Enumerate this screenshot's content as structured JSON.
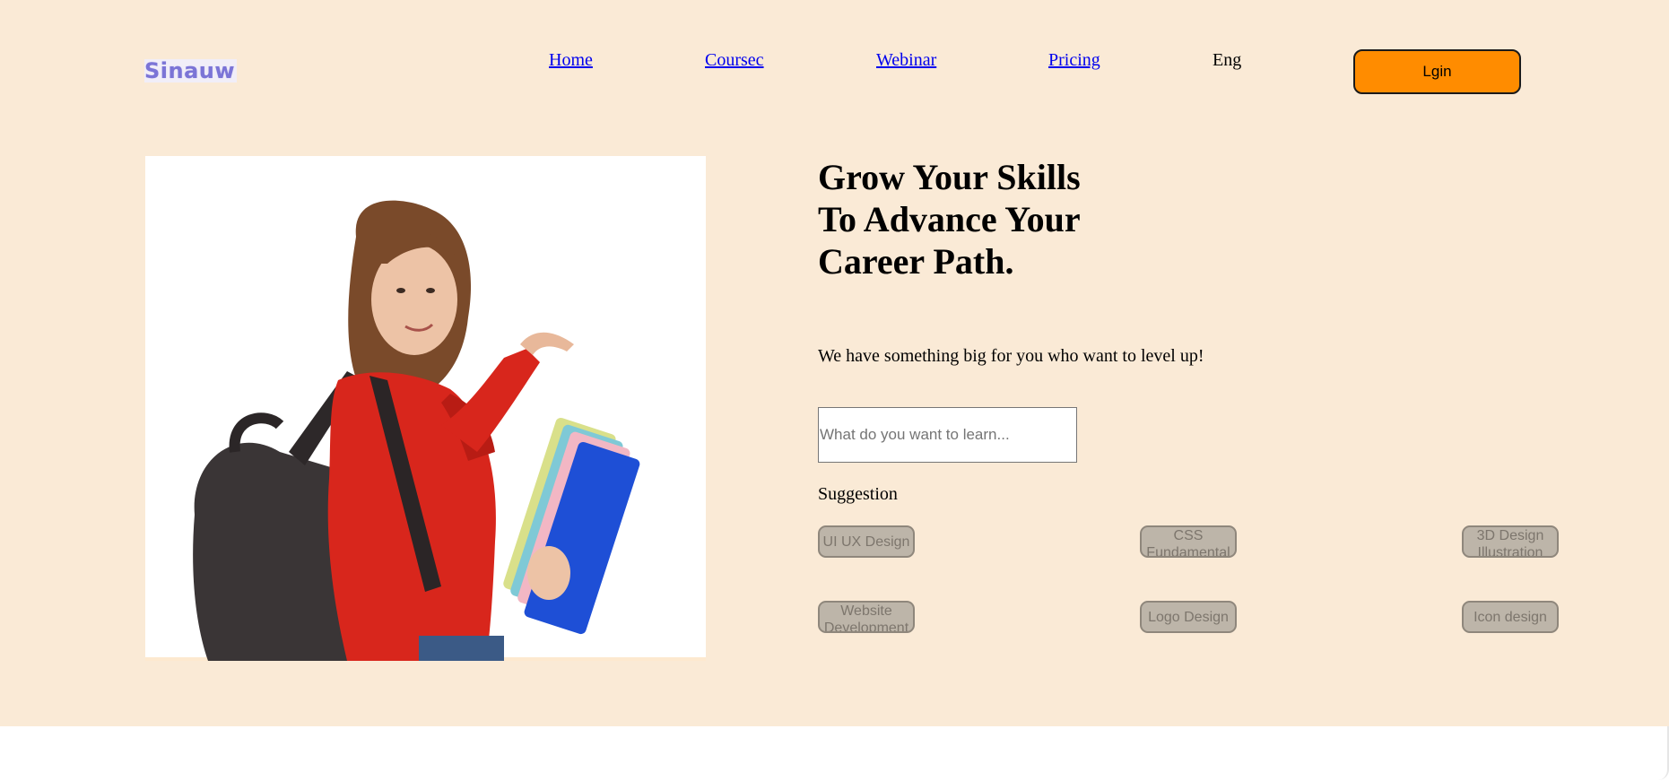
{
  "brand": {
    "logo_text": "Sinauw"
  },
  "nav": {
    "items": [
      {
        "label": "Home"
      },
      {
        "label": "Coursec"
      },
      {
        "label": "Webinar"
      },
      {
        "label": "Pricing"
      }
    ],
    "language": "Eng",
    "login_label": "Lgin"
  },
  "hero": {
    "image_alt": "student-with-backpack-and-folders",
    "headline": "Grow Your Skills To Advance Your Career Path.",
    "subtitle": "We have something big for you who want to level up!",
    "search": {
      "placeholder": "What do you want to learn...",
      "value": ""
    },
    "suggestion_label": "Suggestion",
    "suggestions": [
      {
        "label": "UI UX Design"
      },
      {
        "label": "CSS Fundamental"
      },
      {
        "label": "3D Design Illustration"
      },
      {
        "label": "Website Development"
      },
      {
        "label": "Logo Design"
      },
      {
        "label": "Icon design"
      }
    ]
  },
  "colors": {
    "hero_background": "#faead6",
    "login_button": "#ff8c00",
    "chip_background": "#bdb5a9",
    "link": "#0000ee",
    "logo": "#7b74d6"
  }
}
